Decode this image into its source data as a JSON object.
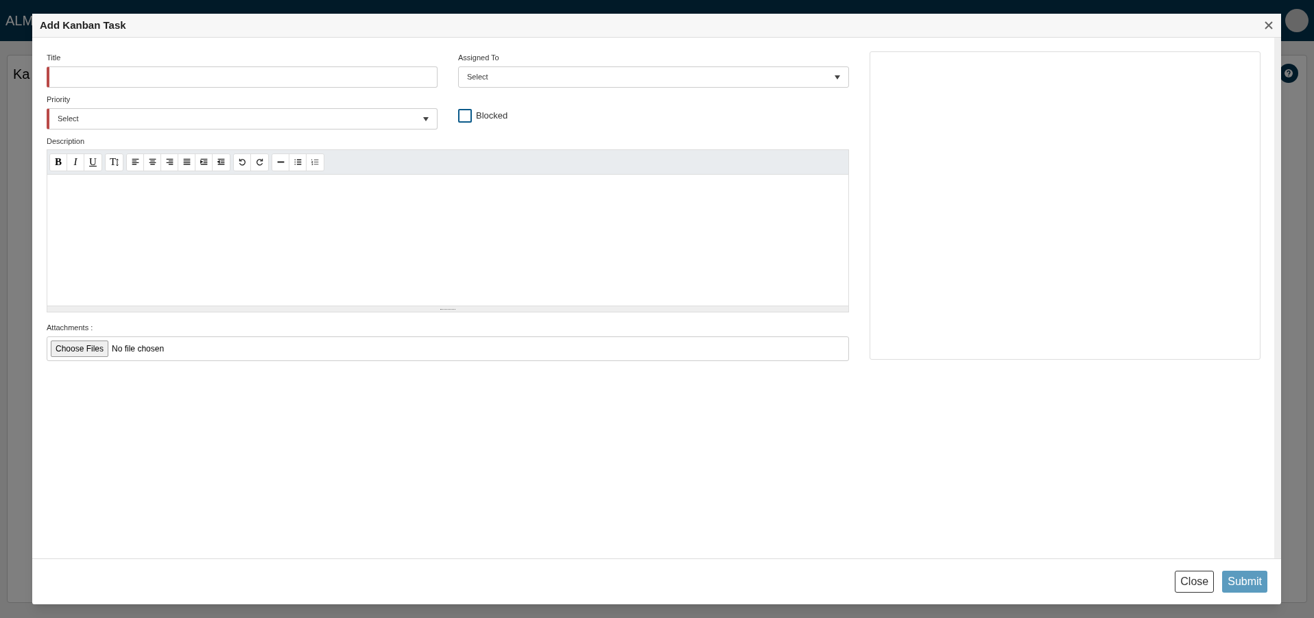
{
  "app": {
    "logo_text": "ALM",
    "page_title": "Ka"
  },
  "modal": {
    "title": "Add Kanban Task",
    "fields": [
      {
        "kind": "text",
        "label": "Title",
        "required": true
      },
      {
        "kind": "select",
        "label": "Assigned To",
        "value": "Select",
        "required": false
      },
      {
        "kind": "select",
        "label": "Priority",
        "value": "Select",
        "required": true
      },
      {
        "kind": "checkbox",
        "label": "Blocked",
        "checked": false
      }
    ],
    "description": {
      "label": "Description",
      "text_buttons": [
        [
          "B",
          "I",
          "U"
        ],
        [
          "T"
        ]
      ]
    },
    "attachments": {
      "label": "Attachments :",
      "button": "Choose Files",
      "status": "No file chosen"
    },
    "buttons": [
      {
        "label": "Close",
        "kind": "secondary"
      },
      {
        "label": "Submit",
        "kind": "primary"
      }
    ]
  }
}
